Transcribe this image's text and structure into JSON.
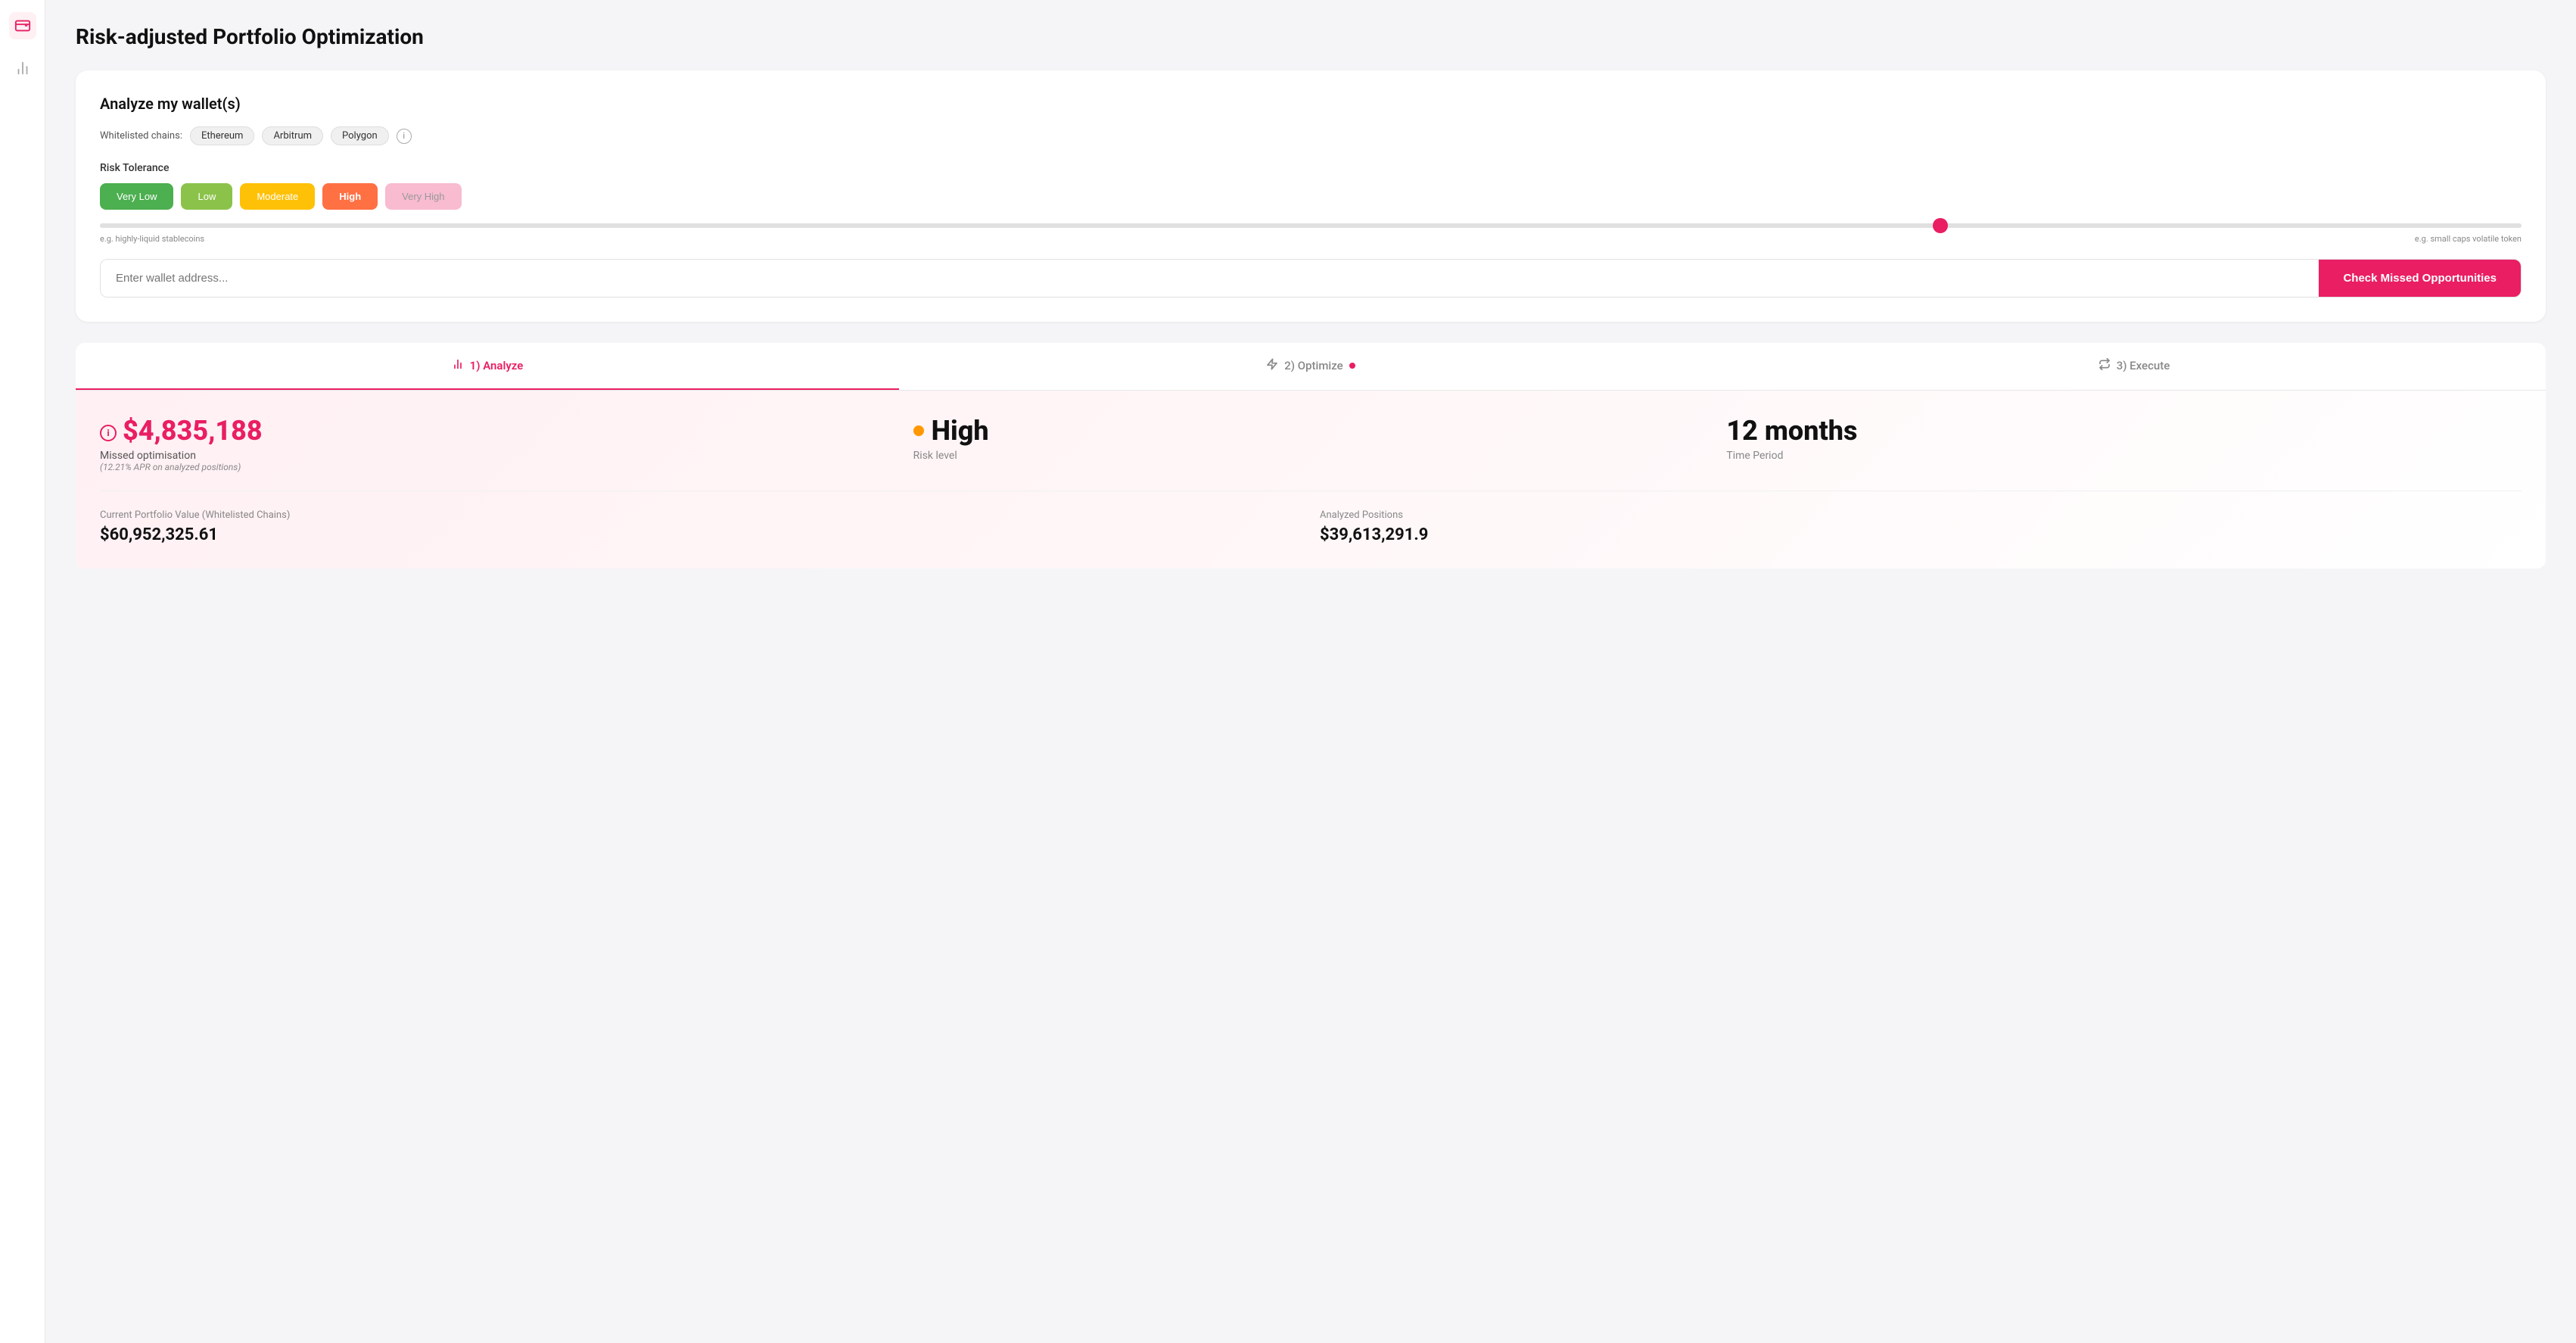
{
  "page": {
    "title": "Risk-adjusted Portfolio Optimization"
  },
  "sidebar": {
    "icons": [
      {
        "name": "wallet-icon",
        "symbol": "⊡",
        "active": true
      },
      {
        "name": "chart-icon",
        "symbol": "📊",
        "active": false
      }
    ]
  },
  "analyze": {
    "title": "Analyze my wallet(s)",
    "chains_label": "Whitelisted chains:",
    "chains": [
      "Ethereum",
      "Arbitrum",
      "Polygon"
    ],
    "risk_tolerance_label": "Risk Tolerance",
    "risk_levels": [
      {
        "key": "very-low",
        "label": "Very Low"
      },
      {
        "key": "low",
        "label": "Low"
      },
      {
        "key": "moderate",
        "label": "Moderate"
      },
      {
        "key": "high",
        "label": "High"
      },
      {
        "key": "very-high",
        "label": "Very High"
      }
    ],
    "slider_left_label": "e.g. highly-liquid stablecoins",
    "slider_right_label": "e.g. small caps volatile token",
    "wallet_placeholder": "Enter wallet address...",
    "check_button_label": "Check Missed Opportunities"
  },
  "tabs": [
    {
      "key": "analyze",
      "label": "1) Analyze",
      "icon": "chart-bar-icon",
      "active": true,
      "dot": false
    },
    {
      "key": "optimize",
      "label": "2) Optimize",
      "icon": "bolt-icon",
      "active": false,
      "dot": true
    },
    {
      "key": "execute",
      "label": "3) Execute",
      "icon": "arrows-icon",
      "active": false,
      "dot": false
    }
  ],
  "stats": {
    "missed_amount": "$4,835,188",
    "missed_label": "Missed optimisation",
    "missed_subtitle": "(12.21% APR on analyzed positions)",
    "risk_level": "High",
    "risk_label": "Risk level",
    "time_period": "12 months",
    "time_label": "Time Period"
  },
  "portfolio": {
    "current_label": "Current Portfolio Value (Whitelisted Chains)",
    "current_value": "$60,952,325.61",
    "analyzed_label": "Analyzed Positions",
    "analyzed_value": "$39,613,291.9"
  }
}
